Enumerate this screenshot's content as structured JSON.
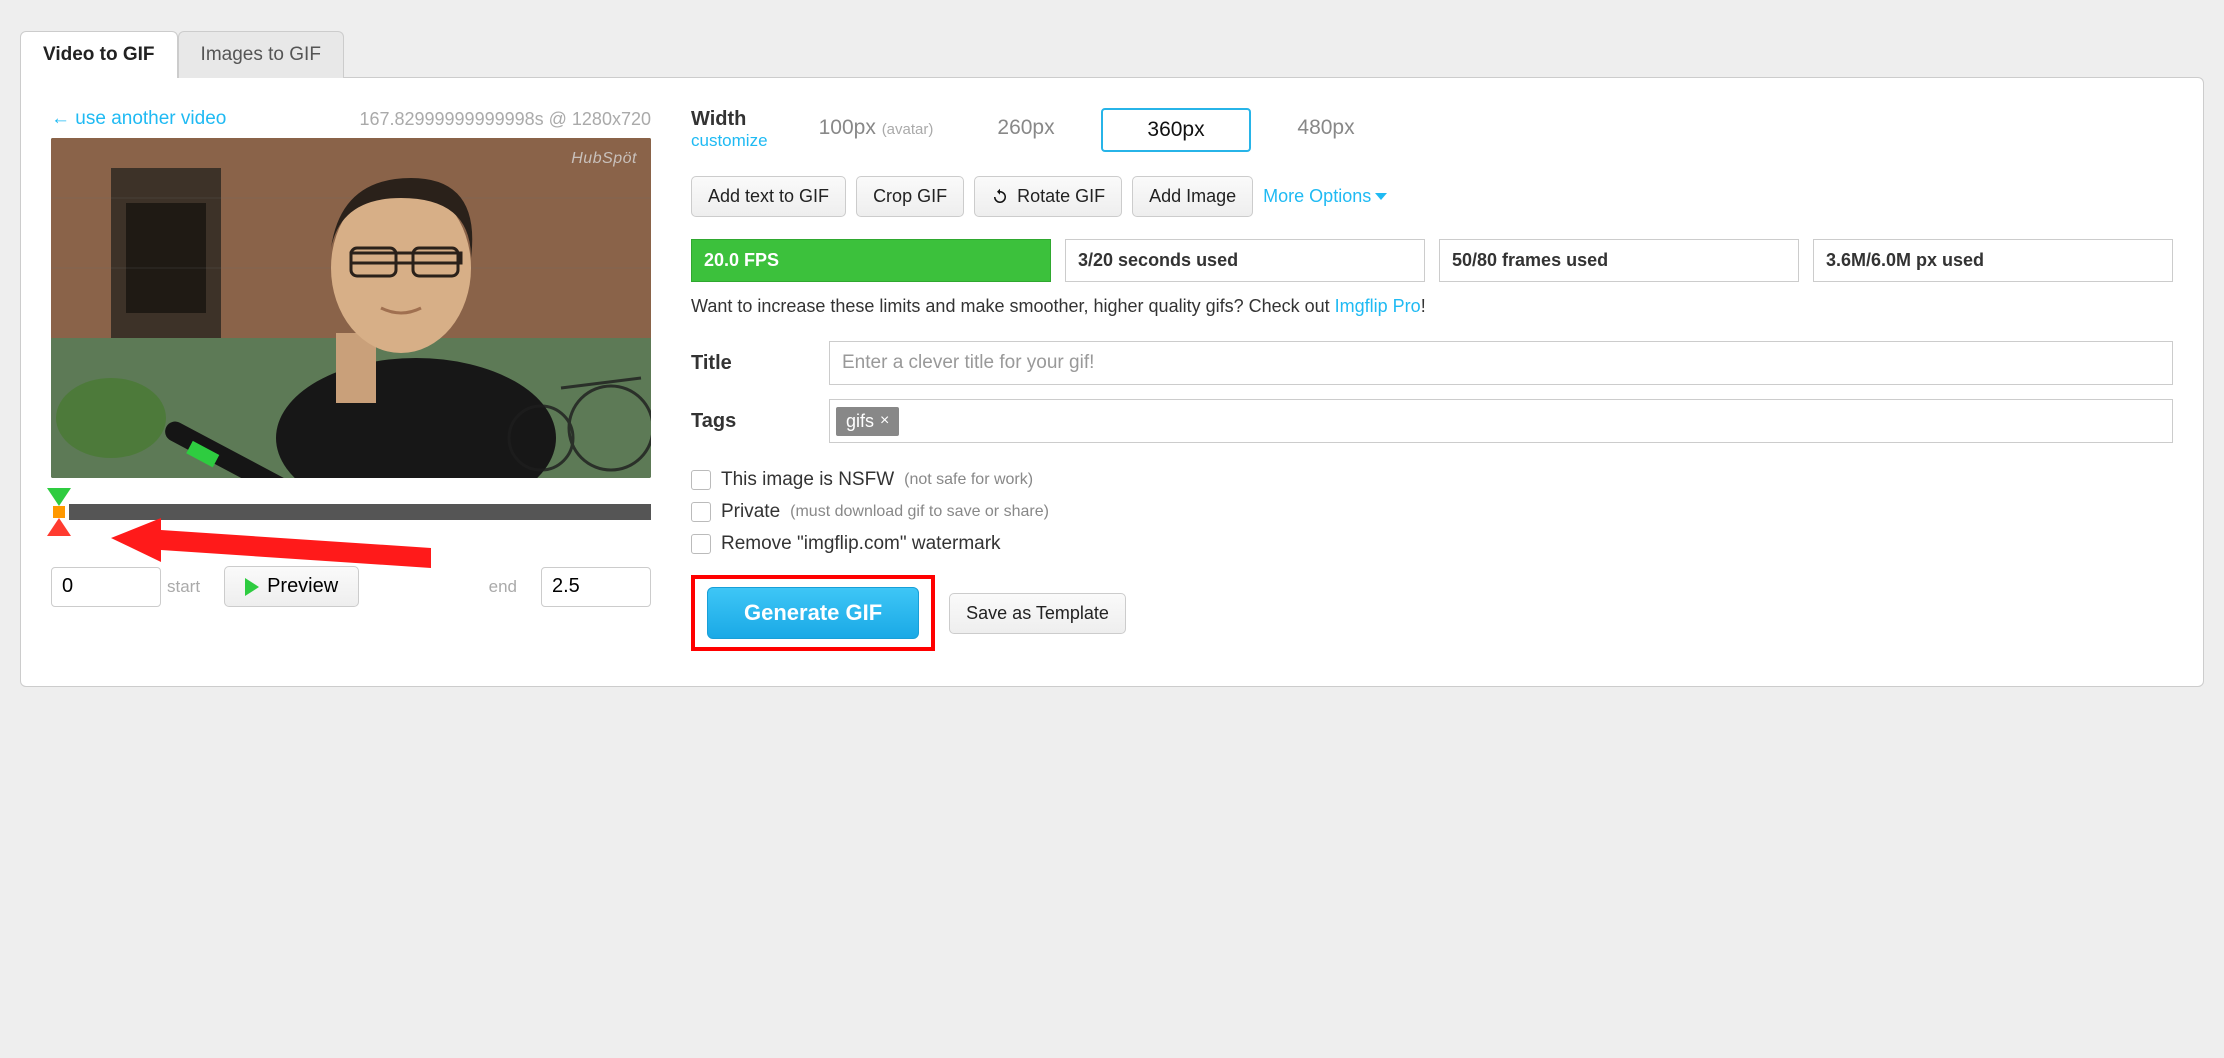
{
  "tabs": {
    "video": "Video to GIF",
    "images": "Images to GIF"
  },
  "left": {
    "use_another": "← use another video",
    "meta": "167.82999999999998s @ 1280x720",
    "hubspot": "HubSpöt",
    "start_label": "start",
    "start_value": "0",
    "end_label": "end",
    "end_value": "2.5",
    "preview": "Preview"
  },
  "right": {
    "width_label": "Width",
    "customize": "customize",
    "widths": [
      {
        "label": "100px",
        "sub": "(avatar)"
      },
      {
        "label": "260px",
        "sub": ""
      },
      {
        "label": "360px",
        "sub": ""
      },
      {
        "label": "480px",
        "sub": ""
      }
    ],
    "actions": {
      "add_text": "Add text to GIF",
      "crop": "Crop GIF",
      "rotate": "Rotate GIF",
      "add_image": "Add Image",
      "more": "More Options"
    },
    "stats": {
      "fps": "20.0 FPS",
      "seconds": "3/20 seconds used",
      "frames": "50/80 frames used",
      "px": "3.6M/6.0M px used"
    },
    "upsell": {
      "text": "Want to increase these limits and make smoother, higher quality gifs? Check out ",
      "link": "Imgflip Pro",
      "tail": "!"
    },
    "title_label": "Title",
    "title_placeholder": "Enter a clever title for your gif!",
    "tags_label": "Tags",
    "tag_value": "gifs",
    "checks": {
      "nsfw": "This image is NSFW",
      "nsfw_sub": "(not safe for work)",
      "private": "Private",
      "private_sub": "(must download gif to save or share)",
      "watermark": "Remove \"imgflip.com\" watermark"
    },
    "generate": "Generate GIF",
    "save_template": "Save as Template"
  }
}
